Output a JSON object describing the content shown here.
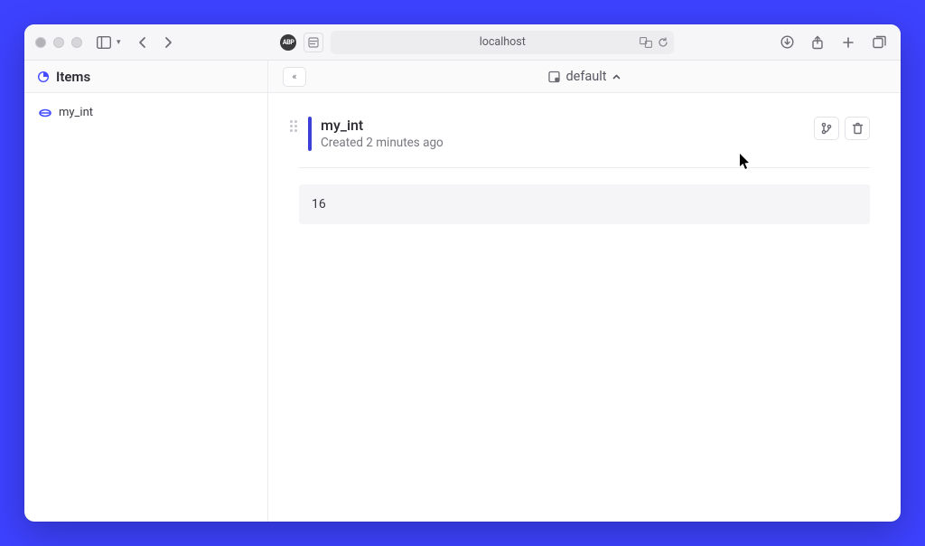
{
  "browser": {
    "url_display": "localhost",
    "abp_label": "ABP"
  },
  "topbar": {
    "left_title": "Items",
    "collapse_glyph": "«",
    "workspace_name": "default"
  },
  "sidebar": {
    "items": [
      {
        "label": "my_int",
        "type": "int"
      }
    ]
  },
  "item": {
    "title": "my_int",
    "meta": "Created 2 minutes ago",
    "value": "16"
  }
}
